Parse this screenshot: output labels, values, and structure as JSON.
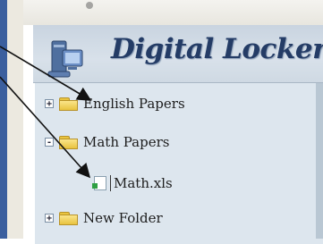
{
  "header": {
    "title": "Digital Locker",
    "icon": "computer-with-tower-icon"
  },
  "tree": {
    "items": [
      {
        "label": "English Papers",
        "expander": "+",
        "icon": "folder-icon"
      },
      {
        "label": "Math Papers",
        "expander": "-",
        "icon": "folder-icon"
      },
      {
        "label": "Math.xls",
        "icon": "spreadsheet-file-icon"
      },
      {
        "label": "New Folder",
        "expander": "+",
        "icon": "folder-icon"
      }
    ]
  },
  "colors": {
    "title": "#243c66",
    "panel": "#dde6ee",
    "arrow": "#111111"
  }
}
